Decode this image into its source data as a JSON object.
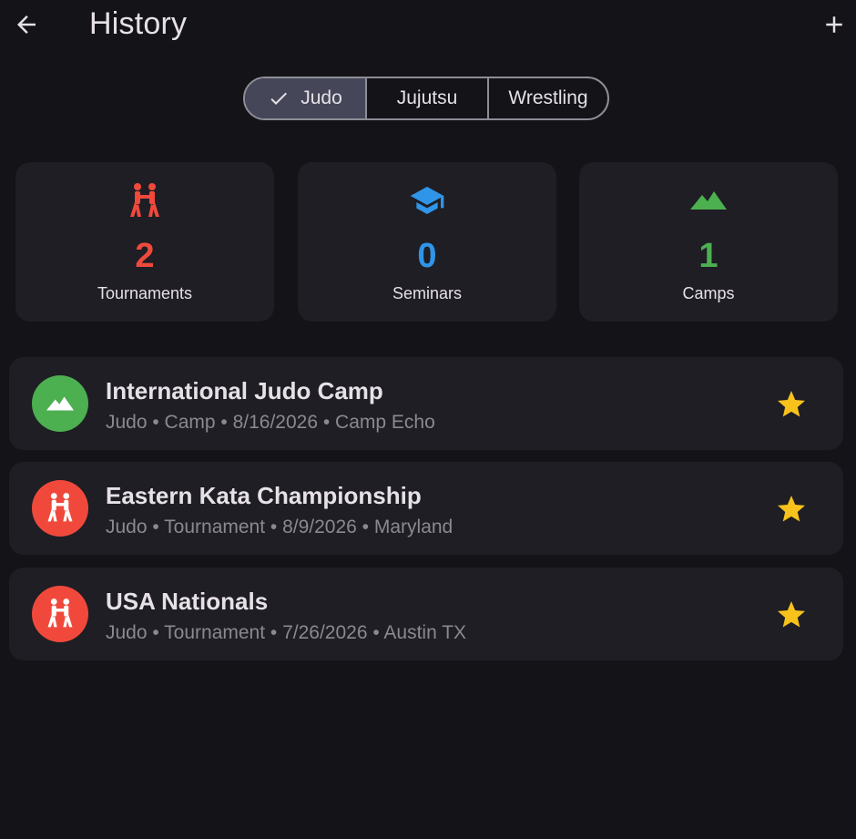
{
  "appbar": {
    "title": "History",
    "back_icon": "arrow-left-icon",
    "add_icon": "plus-icon"
  },
  "filter": {
    "options": [
      "Judo",
      "Jujutsu",
      "Wrestling"
    ],
    "selected": "Judo"
  },
  "stats": [
    {
      "label": "Tournaments",
      "value": "2",
      "icon": "tournament-icon",
      "color": "#f0493c"
    },
    {
      "label": "Seminars",
      "value": "0",
      "icon": "graduation-cap-icon",
      "color": "#2f95e8"
    },
    {
      "label": "Camps",
      "value": "1",
      "icon": "mountain-icon",
      "color": "#4caf50"
    }
  ],
  "events": [
    {
      "title": "International Judo Camp",
      "subtitle": "Judo • Camp • 8/16/2026 • Camp Echo",
      "icon": "mountain-icon",
      "color": "#4caf50",
      "starred": true
    },
    {
      "title": "Eastern Kata Championship",
      "subtitle": "Judo • Tournament • 8/9/2026 • Maryland",
      "icon": "tournament-icon",
      "color": "#f0493c",
      "starred": true
    },
    {
      "title": "USA Nationals",
      "subtitle": "Judo • Tournament • 7/26/2026 • Austin TX",
      "icon": "tournament-icon",
      "color": "#f0493c",
      "starred": true
    }
  ],
  "colors": {
    "star": "#f7c21c",
    "background": "#131318",
    "card": "#1e1e24"
  }
}
